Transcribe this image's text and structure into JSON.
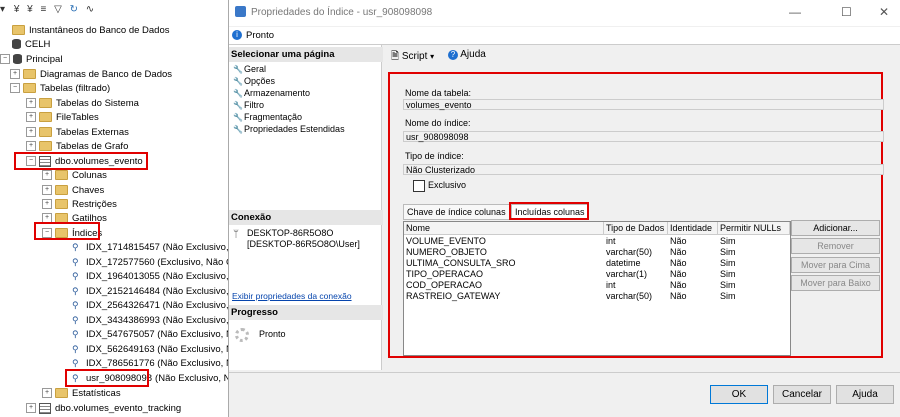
{
  "tree": {
    "items": [
      {
        "label": "Instantâneos do Banco de Dados",
        "icon": "folder-icon"
      },
      {
        "label": "CELH",
        "icon": "database-icon"
      },
      {
        "label": "Principal",
        "icon": "database-icon"
      },
      {
        "label": "Diagramas de Banco de Dados",
        "icon": "folder-icon"
      },
      {
        "label": "Tabelas (filtrado)",
        "icon": "folder-icon"
      },
      {
        "label": "Tabelas do Sistema",
        "icon": "folder-icon"
      },
      {
        "label": "FileTables",
        "icon": "folder-icon"
      },
      {
        "label": "Tabelas Externas",
        "icon": "folder-icon"
      },
      {
        "label": "Tabelas de Grafo",
        "icon": "folder-icon"
      },
      {
        "label": "dbo.volumes_evento",
        "icon": "table-icon"
      },
      {
        "label": "Colunas",
        "icon": "folder-icon"
      },
      {
        "label": "Chaves",
        "icon": "folder-icon"
      },
      {
        "label": "Restrições",
        "icon": "folder-icon"
      },
      {
        "label": "Gatilhos",
        "icon": "folder-icon"
      },
      {
        "label": "Índices",
        "icon": "folder-icon"
      },
      {
        "label": "IDX_1714815457 (Não Exclusivo, N",
        "icon": "index-icon"
      },
      {
        "label": "IDX_172577560 (Exclusivo, Não Cl",
        "icon": "index-icon"
      },
      {
        "label": "IDX_1964013055 (Não Exclusivo, N",
        "icon": "index-icon"
      },
      {
        "label": "IDX_2152146484 (Não Exclusivo, N",
        "icon": "index-icon"
      },
      {
        "label": "IDX_2564326471 (Não Exclusivo, N",
        "icon": "index-icon"
      },
      {
        "label": "IDX_3434386993 (Não Exclusivo, N",
        "icon": "index-icon"
      },
      {
        "label": "IDX_547675057 (Não Exclusivo, N",
        "icon": "index-icon"
      },
      {
        "label": "IDX_562649163 (Não Exclusivo, N",
        "icon": "index-icon"
      },
      {
        "label": "IDX_786561776 (Não Exclusivo, N",
        "icon": "index-icon"
      },
      {
        "label": "usr_908098098",
        "icon": "index-icon"
      },
      {
        "label": "Estatísticas",
        "icon": "folder-icon"
      },
      {
        "label": "dbo.volumes_evento_tracking",
        "icon": "table-icon"
      }
    ],
    "selected_suffix": "(Não Exclusivo, Na"
  },
  "dialog": {
    "title": "Propriedades do Índice - usr_908098098",
    "status": "Pronto",
    "select_page_header": "Selecionar uma página",
    "pages": [
      "Geral",
      "Opções",
      "Armazenamento",
      "Filtro",
      "Fragmentação",
      "Propriedades Estendidas"
    ],
    "connection_header": "Conexão",
    "connection_server": "DESKTOP-86R5O8O",
    "connection_user": "[DESKTOP-86R5O8O\\User]",
    "connection_link": "Exibir propriedades da conexão",
    "progress_header": "Progresso",
    "progress_status": "Pronto",
    "script_label": "Script",
    "help_label": "Ajuda",
    "table_name_label": "Nome da tabela:",
    "table_name_value": "volumes_evento",
    "index_name_label": "Nome do índice:",
    "index_name_value": "usr_908098098",
    "index_type_label": "Tipo de índice:",
    "index_type_value": "Não Clusterizado",
    "unique_label": "Exclusivo",
    "tab_key_columns": "Chave de índice colunas",
    "tab_included_columns": "Incluídas colunas",
    "grid": {
      "headers": [
        "Nome",
        "Tipo de Dados",
        "Identidade",
        "Permitir NULLs"
      ],
      "rows": [
        [
          "VOLUME_EVENTO",
          "int",
          "Não",
          "Sim"
        ],
        [
          "NUMERO_OBJETO",
          "varchar(50)",
          "Não",
          "Sim"
        ],
        [
          "ULTIMA_CONSULTA_SRO",
          "datetime",
          "Não",
          "Sim"
        ],
        [
          "TIPO_OPERACAO",
          "varchar(1)",
          "Não",
          "Sim"
        ],
        [
          "COD_OPERACAO",
          "int",
          "Não",
          "Sim"
        ],
        [
          "RASTREIO_GATEWAY",
          "varchar(50)",
          "Não",
          "Sim"
        ]
      ]
    },
    "side_buttons": [
      "Adicionar...",
      "Remover",
      "Mover para Cima",
      "Mover para Baixo"
    ],
    "ok": "OK",
    "cancel": "Cancelar",
    "help": "Ajuda"
  }
}
